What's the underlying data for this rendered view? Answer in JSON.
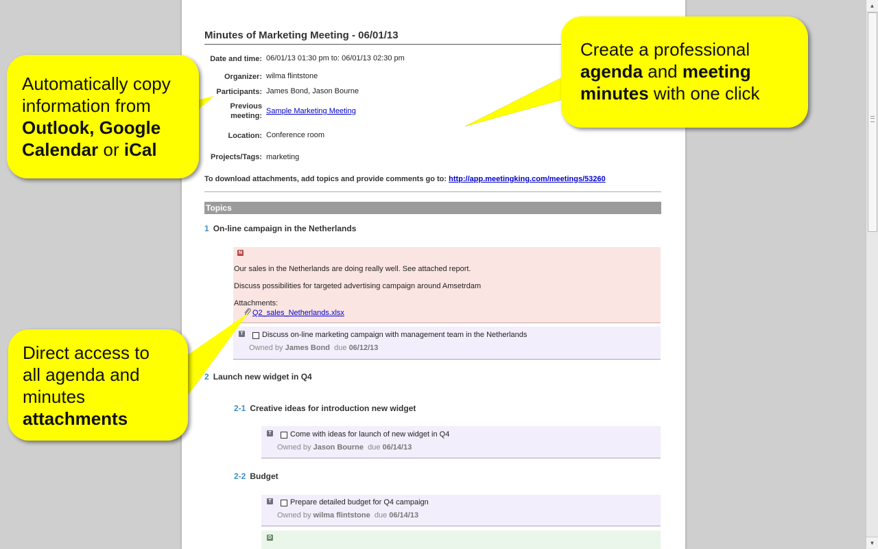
{
  "document": {
    "title": "Minutes of Marketing Meeting - 06/01/13",
    "meta": {
      "date_label": "Date and time:",
      "date_value": "06/01/13 01:30 pm to: 06/01/13 02:30 pm",
      "organizer_label": "Organizer:",
      "organizer_value": "wilma flintstone",
      "participants_label": "Participants:",
      "participants_value": "James Bond, Jason Bourne",
      "previous_label_1": "Previous",
      "previous_label_2": "meeting:",
      "previous_value": "Sample Marketing Meeting",
      "location_label": "Location:",
      "location_value": "Conference room",
      "projects_label": "Projects/Tags:",
      "projects_value": "marketing"
    },
    "download_text": "To download attachments, add topics and provide comments go to:",
    "download_link": "http://app.meetingking.com/meetings/53260",
    "topics_header": "Topics",
    "topics": [
      {
        "num": "1",
        "title": "On-line campaign in the Netherlands",
        "note": {
          "badge": "N",
          "line1": "Our sales in the Netherlands are doing really well. See attached report.",
          "line2": "Discuss possibilities for targeted advertising campaign around Amsetrdam",
          "attachments_label": "Attachments:",
          "attachment": "Q2_sales_Netherlands.xlsx"
        },
        "task": {
          "badge": "T",
          "text": "Discuss on-line marketing campaign with management team in the Netherlands",
          "owned_by": "Owned by",
          "owner": "James Bond",
          "due_label": "due",
          "due": "06/12/13"
        }
      },
      {
        "num": "2",
        "title": "Launch new widget in Q4",
        "subtopics": [
          {
            "num": "2-1",
            "title": "Creative ideas for introduction new widget",
            "task": {
              "badge": "T",
              "text": "Come with ideas for launch of new widget in Q4",
              "owned_by": "Owned by",
              "owner": "Jason Bourne",
              "due_label": "due",
              "due": "06/14/13"
            }
          },
          {
            "num": "2-2",
            "title": "Budget",
            "task": {
              "badge": "T",
              "text": "Prepare detailed budget for Q4 campaign",
              "owned_by": "Owned by",
              "owner": "wilma flintstone",
              "due_label": "due",
              "due": "06/14/13"
            },
            "decision_badge": "D"
          }
        ]
      }
    ]
  },
  "callouts": {
    "copy": {
      "line1": "Automatically copy",
      "line2": "information from",
      "bold1": "Outlook, Google",
      "bold2": "Calendar",
      "mid": "or",
      "bold3": "iCal"
    },
    "agenda": {
      "line1": "Create a professional",
      "bold1": "agenda",
      "mid1": "and",
      "bold2": "meeting",
      "bold3": "minutes",
      "tail": "with one click"
    },
    "attachments": {
      "line1": "Direct access to",
      "line2": "all agenda and",
      "line3": "minutes",
      "bold1": "attachments"
    }
  },
  "colors": {
    "callout": "#ffff00",
    "link": "#0000cc",
    "topic_number": "#3d8fc7",
    "note_bg": "#fbe5e2",
    "task_bg": "#f2eefb"
  },
  "icons": [
    "paperclip-icon",
    "scroll-up-icon",
    "scroll-down-icon"
  ]
}
